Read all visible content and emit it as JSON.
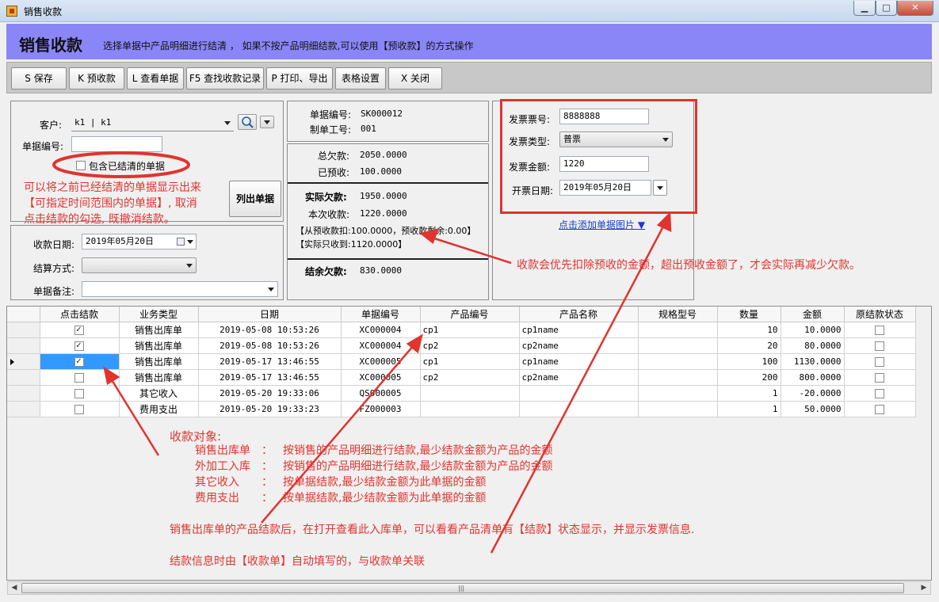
{
  "window": {
    "title": "销售收款",
    "min": "▁",
    "max": "□",
    "close": "✕"
  },
  "header": {
    "title": "销售收款",
    "hint": "选择单据中产品明细进行结清 ， 如果不按产品明细结款,可以使用【预收款】的方式操作"
  },
  "toolbar": [
    {
      "label": "S 保存"
    },
    {
      "label": "K 预收款"
    },
    {
      "label": "L 查看单据"
    },
    {
      "label": "F5 查找收款记录"
    },
    {
      "label": "P 打印、导出"
    },
    {
      "label": "表格设置"
    },
    {
      "label": "X 关闭"
    }
  ],
  "filter": {
    "customer_label": "客户:",
    "customer_value": "k1  |  k1",
    "doc_no_label": "单据编号:",
    "doc_no_value": "",
    "include_settled_label": "包含已结清的单据",
    "list_button": "列出单据"
  },
  "receipt": {
    "date_label": "收款日期:",
    "date_value": "2019年05月20日",
    "method_label": "结算方式:",
    "method_value": "",
    "remark_label": "单据备注:",
    "remark_value": ""
  },
  "docinfo": {
    "no_label": "单据编号:",
    "no_value": "SK000012",
    "worker_label": "制单工号:",
    "worker_value": "001"
  },
  "totals": {
    "owed_label": "总欠款:",
    "owed_value": "2050.0000",
    "prepaid_label": "已预收:",
    "prepaid_value": "100.0000",
    "actual_owed_label": "实际欠款:",
    "actual_owed_value": "1950.0000",
    "this_receipt_label": "本次收款:",
    "this_receipt_value": "1220.0000",
    "deduct_line": "【从预收款扣:100.0000，预收款剩余:0.00】",
    "actual_received_line": "【实际只收到:1120.0000】",
    "balance_label": "结余欠款:",
    "balance_value": "830.0000"
  },
  "invoice": {
    "no_label": "发票票号:",
    "no_value": "8888888",
    "type_label": "发票类型:",
    "type_value": "普票",
    "amount_label": "发票金额:",
    "amount_value": "1220",
    "date_label": "开票日期:",
    "date_value": "2019年05月20日",
    "add_image_link": "点击添加单据图片 ▼"
  },
  "grid": {
    "columns": [
      "点击结款",
      "业务类型",
      "日期",
      "单据编号",
      "产品编号",
      "产品名称",
      "规格型号",
      "数量",
      "金额",
      "原结款状态"
    ],
    "rows": [
      {
        "checked": true,
        "type": "销售出库单",
        "date": "2019-05-08  10:53:26",
        "doc": "XC000004",
        "pcode": "cp1",
        "pname": "cp1name",
        "spec": "",
        "qty": "10",
        "amount": "10.0000",
        "orig": false,
        "selected": false
      },
      {
        "checked": true,
        "type": "销售出库单",
        "date": "2019-05-08  10:53:26",
        "doc": "XC000004",
        "pcode": "cp2",
        "pname": "cp2name",
        "spec": "",
        "qty": "20",
        "amount": "80.0000",
        "orig": false,
        "selected": false
      },
      {
        "checked": true,
        "type": "销售出库单",
        "date": "2019-05-17  13:46:55",
        "doc": "XC000005",
        "pcode": "cp1",
        "pname": "cp1name",
        "spec": "",
        "qty": "100",
        "amount": "1130.0000",
        "orig": false,
        "selected": true
      },
      {
        "checked": false,
        "type": "销售出库单",
        "date": "2019-05-17  13:46:55",
        "doc": "XC000005",
        "pcode": "cp2",
        "pname": "cp2name",
        "spec": "",
        "qty": "200",
        "amount": "800.0000",
        "orig": false,
        "selected": false
      },
      {
        "checked": false,
        "type": "其它收入",
        "date": "2019-05-20  19:33:06",
        "doc": "QS000005",
        "pcode": "",
        "pname": "",
        "spec": "",
        "qty": "1",
        "amount": "-20.0000",
        "orig": false,
        "selected": false
      },
      {
        "checked": false,
        "type": "费用支出",
        "date": "2019-05-20  19:33:23",
        "doc": "FZ000003",
        "pcode": "",
        "pname": "",
        "spec": "",
        "qty": "1",
        "amount": "50.0000",
        "orig": false,
        "selected": false
      }
    ]
  },
  "annotations": {
    "settled_note_1": "可以将之前已经结清的单据显示出来",
    "settled_note_2": "【可指定时间范围内的单据】, 取消",
    "settled_note_3": "点击结款的勾选, 既撤消结款。",
    "prepaid_note": "收款会优先扣除预收的金额，超出预收金额了，才会实际再减少欠款。",
    "objects_title": "收款对象:",
    "objects": [
      {
        "name": "销售出库单",
        "colon": "：",
        "desc": "按销售的产品明细进行结款,最少结款金额为产品的金额"
      },
      {
        "name": "外加工入库",
        "colon": "：",
        "desc": "按销售的产品明细进行结款,最少结款金额为产品的金额"
      },
      {
        "name": "其它收入",
        "colon": "：",
        "desc": "按单据结款,最少结款金额为此单据的金额"
      },
      {
        "name": "费用支出",
        "colon": "：",
        "desc": "按单据结款,最少结款金额为此单据的金额"
      }
    ],
    "after_note": "销售出库单的产品结款后，在打开查看此入库单，可以看看产品清单有【结款】状态显示，并显示发票信息.",
    "link_note": "结款信息时由【收款单】自动填写的，与收款单关联"
  },
  "colors": {
    "header_bg": "#8a86f7",
    "annotation": "#e0342f",
    "selection": "#3399ff",
    "link": "#1a3cc8"
  }
}
